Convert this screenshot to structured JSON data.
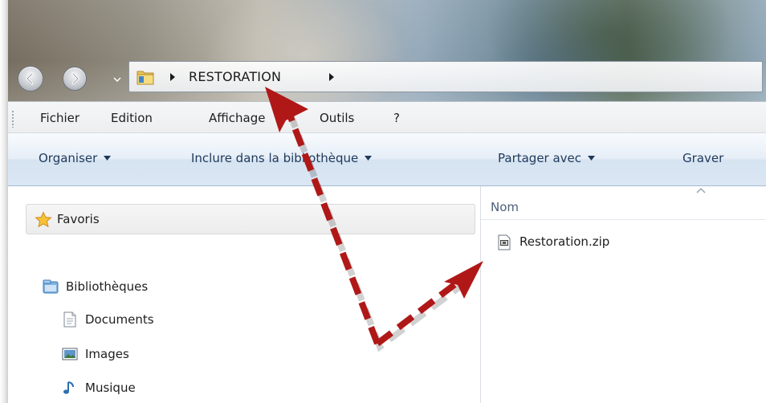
{
  "address_bar": {
    "breadcrumbs": [
      "RESTORATION"
    ]
  },
  "menu": {
    "items": [
      "Fichier",
      "Edition",
      "Affichage",
      "Outils",
      "?"
    ]
  },
  "toolbar": {
    "organiser": "Organiser",
    "inclure": "Inclure dans la bibliothèque",
    "partager": "Partager avec",
    "graver": "Graver"
  },
  "navigation": {
    "favorites": "Favoris",
    "libraries": "Bibliothèques",
    "items": [
      "Documents",
      "Images",
      "Musique"
    ]
  },
  "content": {
    "column_header": "Nom",
    "files": [
      {
        "name": "Restoration.zip",
        "icon": "zip-archive-icon"
      }
    ]
  },
  "annotation": {
    "arrow_color": "#b01818"
  }
}
